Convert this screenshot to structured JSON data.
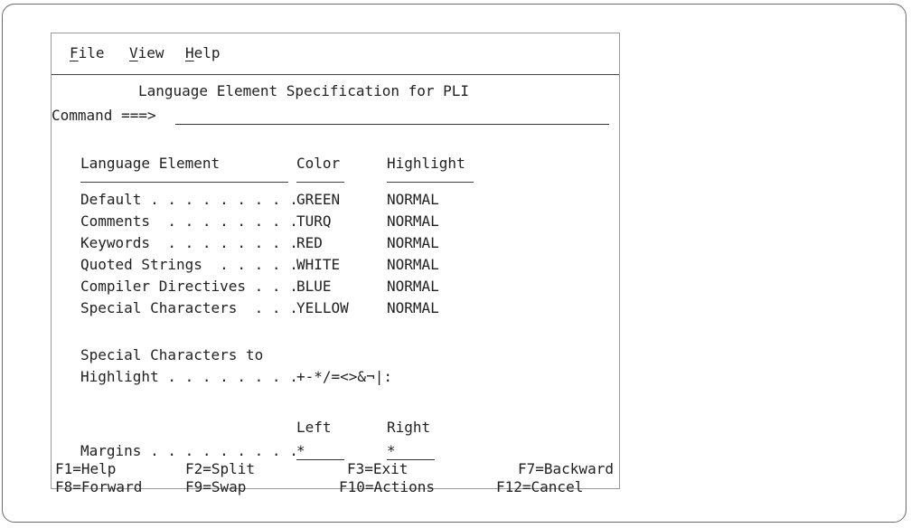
{
  "menu": [
    {
      "key": "F",
      "rest": "ile"
    },
    {
      "key": "V",
      "rest": "iew"
    },
    {
      "key": "H",
      "rest": "elp"
    }
  ],
  "title": "Language Element Specification for PLI",
  "command": {
    "label": "Command ===>",
    "value": ""
  },
  "headers": {
    "element": "Language Element",
    "color": "Color",
    "highlight": "Highlight"
  },
  "rows": [
    {
      "label": "Default . . . . . . . . .",
      "color": "GREEN",
      "highlight": "NORMAL"
    },
    {
      "label": "Comments  . . . . . . . .",
      "color": "TURQ",
      "highlight": "NORMAL"
    },
    {
      "label": "Keywords  . . . . . . . .",
      "color": "RED",
      "highlight": "NORMAL"
    },
    {
      "label": "Quoted Strings  . . . . .",
      "color": "WHITE",
      "highlight": "NORMAL"
    },
    {
      "label": "Compiler Directives . . .",
      "color": "BLUE",
      "highlight": "NORMAL"
    },
    {
      "label": "Special Characters  . . .",
      "color": "YELLOW",
      "highlight": "NORMAL"
    }
  ],
  "special": {
    "line1": "Special Characters to",
    "line2": "Highlight . . . . . . . .",
    "value": "+-*/=<>&¬|:"
  },
  "margins": {
    "left_header": "Left",
    "right_header": "Right",
    "label": "Margins . . . . . . . . .",
    "left_value": "*",
    "right_value": "*"
  },
  "fkeys": [
    [
      "F1=Help",
      "F2=Split",
      "F3=Exit",
      "F7=Backward"
    ],
    [
      "F8=Forward",
      "F9=Swap",
      "F10=Actions",
      "F12=Cancel"
    ]
  ]
}
